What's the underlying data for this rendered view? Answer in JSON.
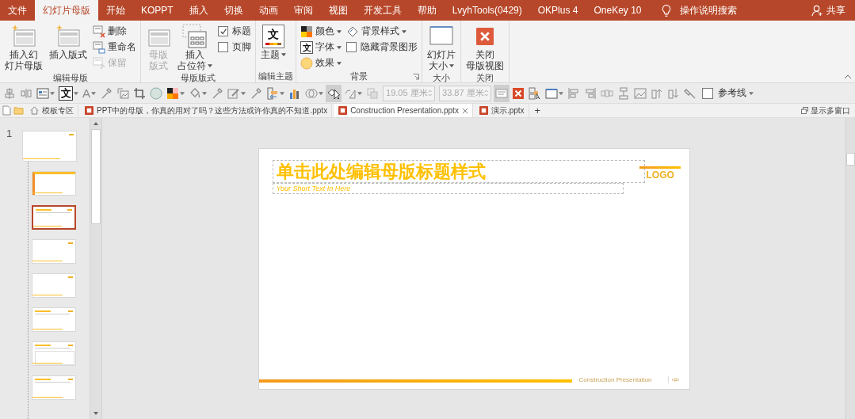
{
  "menu_tabs": [
    {
      "label": "文件",
      "selected": false
    },
    {
      "label": "幻灯片母版",
      "selected": true
    },
    {
      "label": "开始",
      "selected": false
    },
    {
      "label": "KOPPT",
      "selected": false
    },
    {
      "label": "插入",
      "selected": false
    },
    {
      "label": "切换",
      "selected": false
    },
    {
      "label": "动画",
      "selected": false
    },
    {
      "label": "审阅",
      "selected": false
    },
    {
      "label": "视图",
      "selected": false
    },
    {
      "label": "开发工具",
      "selected": false
    },
    {
      "label": "帮助",
      "selected": false
    },
    {
      "label": "LvyhTools(0429)",
      "selected": false
    },
    {
      "label": "OKPlus 4",
      "selected": false
    },
    {
      "label": "OneKey 10",
      "selected": false
    }
  ],
  "tell_me": "操作说明搜索",
  "share": "共享",
  "ribbon_groups": [
    {
      "label": "编辑母版",
      "dialog_launcher": false,
      "items": [
        {
          "kind": "large",
          "lines": [
            "插入幻",
            "灯片母版"
          ],
          "disabled": false,
          "dropdown": false
        },
        {
          "kind": "large",
          "lines": [
            "插入版式"
          ],
          "disabled": false,
          "dropdown": false
        },
        {
          "kind": "small",
          "label": "删除",
          "disabled": false,
          "dropdown": false
        },
        {
          "kind": "small",
          "label": "重命名",
          "disabled": false,
          "dropdown": false
        },
        {
          "kind": "small",
          "label": "保留",
          "disabled": true,
          "dropdown": false
        }
      ]
    },
    {
      "label": "母版版式",
      "dialog_launcher": false,
      "items": [
        {
          "kind": "large",
          "lines": [
            "母版",
            "版式"
          ],
          "disabled": true,
          "dropdown": false
        },
        {
          "kind": "large",
          "lines": [
            "插入",
            "占位符"
          ],
          "disabled": false,
          "dropdown": true
        },
        {
          "kind": "checkbox",
          "label": "标题",
          "checked": true,
          "disabled": false
        },
        {
          "kind": "checkbox",
          "label": "页脚",
          "checked": false,
          "disabled": false
        }
      ]
    },
    {
      "label": "编辑主题",
      "dialog_launcher": false,
      "items": [
        {
          "kind": "large",
          "lines": [
            "主题"
          ],
          "glyph": "文",
          "disabled": false,
          "dropdown": true
        }
      ]
    },
    {
      "label": "背景",
      "dialog_launcher": true,
      "items": [
        {
          "kind": "small",
          "label": "颜色",
          "disabled": false,
          "dropdown": true
        },
        {
          "kind": "small",
          "label": "字体",
          "glyph": "文",
          "disabled": false,
          "dropdown": true
        },
        {
          "kind": "small",
          "label": "效果",
          "disabled": false,
          "dropdown": true
        },
        {
          "kind": "small",
          "label": "背景样式",
          "disabled": false,
          "dropdown": true
        },
        {
          "kind": "checkbox",
          "label": "隐藏背景图形",
          "checked": false,
          "disabled": false
        }
      ]
    },
    {
      "label": "大小",
      "dialog_launcher": false,
      "items": [
        {
          "kind": "large",
          "lines": [
            "幻灯片",
            "大小"
          ],
          "disabled": false,
          "dropdown": true
        }
      ]
    },
    {
      "label": "关闭",
      "dialog_launcher": false,
      "items": [
        {
          "kind": "large",
          "lines": [
            "关闭",
            "母版视图"
          ],
          "disabled": false,
          "dropdown": false
        }
      ]
    }
  ],
  "toolbar": [
    {
      "kind": "button",
      "pressed": false
    },
    {
      "kind": "button",
      "pressed": false
    },
    {
      "kind": "dropdown",
      "pressed": false
    },
    {
      "kind": "dropdown",
      "pressed": false,
      "glyph": "文"
    },
    {
      "kind": "dropdown",
      "pressed": false,
      "glyph": "A"
    },
    {
      "kind": "button",
      "pressed": false
    },
    {
      "kind": "button",
      "pressed": false
    },
    {
      "kind": "button",
      "pressed": false
    },
    {
      "kind": "button",
      "pressed": false
    },
    {
      "kind": "dropdown",
      "pressed": false
    },
    {
      "kind": "dropdown",
      "pressed": false
    },
    {
      "kind": "button",
      "pressed": false
    },
    {
      "kind": "dropdown",
      "pressed": false
    },
    {
      "kind": "button",
      "pressed": false
    },
    {
      "kind": "dropdown",
      "pressed": false
    },
    {
      "kind": "button",
      "pressed": false
    },
    {
      "kind": "dropdown",
      "pressed": false
    },
    {
      "kind": "button",
      "pressed": true
    },
    {
      "kind": "dropdown",
      "pressed": false
    },
    {
      "kind": "button",
      "pressed": false
    },
    {
      "kind": "field",
      "value": "19.05 厘米"
    },
    {
      "kind": "field",
      "value": "33.87 厘米"
    },
    {
      "kind": "button",
      "pressed": true
    },
    {
      "kind": "button",
      "pressed": false
    },
    {
      "kind": "button",
      "pressed": false
    },
    {
      "kind": "dropdown",
      "pressed": false
    },
    {
      "kind": "button",
      "pressed": false
    },
    {
      "kind": "button",
      "pressed": false
    },
    {
      "kind": "button",
      "pressed": false
    },
    {
      "kind": "button",
      "pressed": false
    },
    {
      "kind": "button",
      "pressed": false
    },
    {
      "kind": "button",
      "pressed": false
    },
    {
      "kind": "button",
      "pressed": false
    },
    {
      "kind": "button",
      "pressed": false
    },
    {
      "kind": "checkbox",
      "label": "参考线",
      "checked": false
    },
    {
      "kind": "menu",
      "pressed": false
    }
  ],
  "doc_tabs": {
    "items": [
      {
        "kind": "home",
        "label": "模板专区",
        "selected": false
      },
      {
        "kind": "file",
        "label": "PPT中的母版，你真的用对了吗？这些方法或许你真的不知道.pptx",
        "selected": false
      },
      {
        "kind": "file",
        "label": "Construction Presentation.pptx",
        "selected": true
      },
      {
        "kind": "file",
        "label": "演示.pptx",
        "selected": false
      }
    ],
    "new_tab": "+",
    "multi_window": "显示多窗口"
  },
  "slide_panel": {
    "slide_number": "1",
    "thumbnails": [
      {
        "kind": "master",
        "selected": false
      },
      {
        "kind": "title",
        "selected": false
      },
      {
        "kind": "title_content",
        "selected": true
      },
      {
        "kind": "blank",
        "selected": false
      },
      {
        "kind": "blank",
        "selected": false
      },
      {
        "kind": "content",
        "selected": false
      },
      {
        "kind": "grid",
        "selected": false
      },
      {
        "kind": "content",
        "selected": false
      }
    ]
  },
  "slide": {
    "title": "单击此处编辑母版标题样式",
    "subtitle": "Your Short Text In Here",
    "logo": "LOGO",
    "footer": "Construction Presentation",
    "page_number": "‹#›"
  }
}
